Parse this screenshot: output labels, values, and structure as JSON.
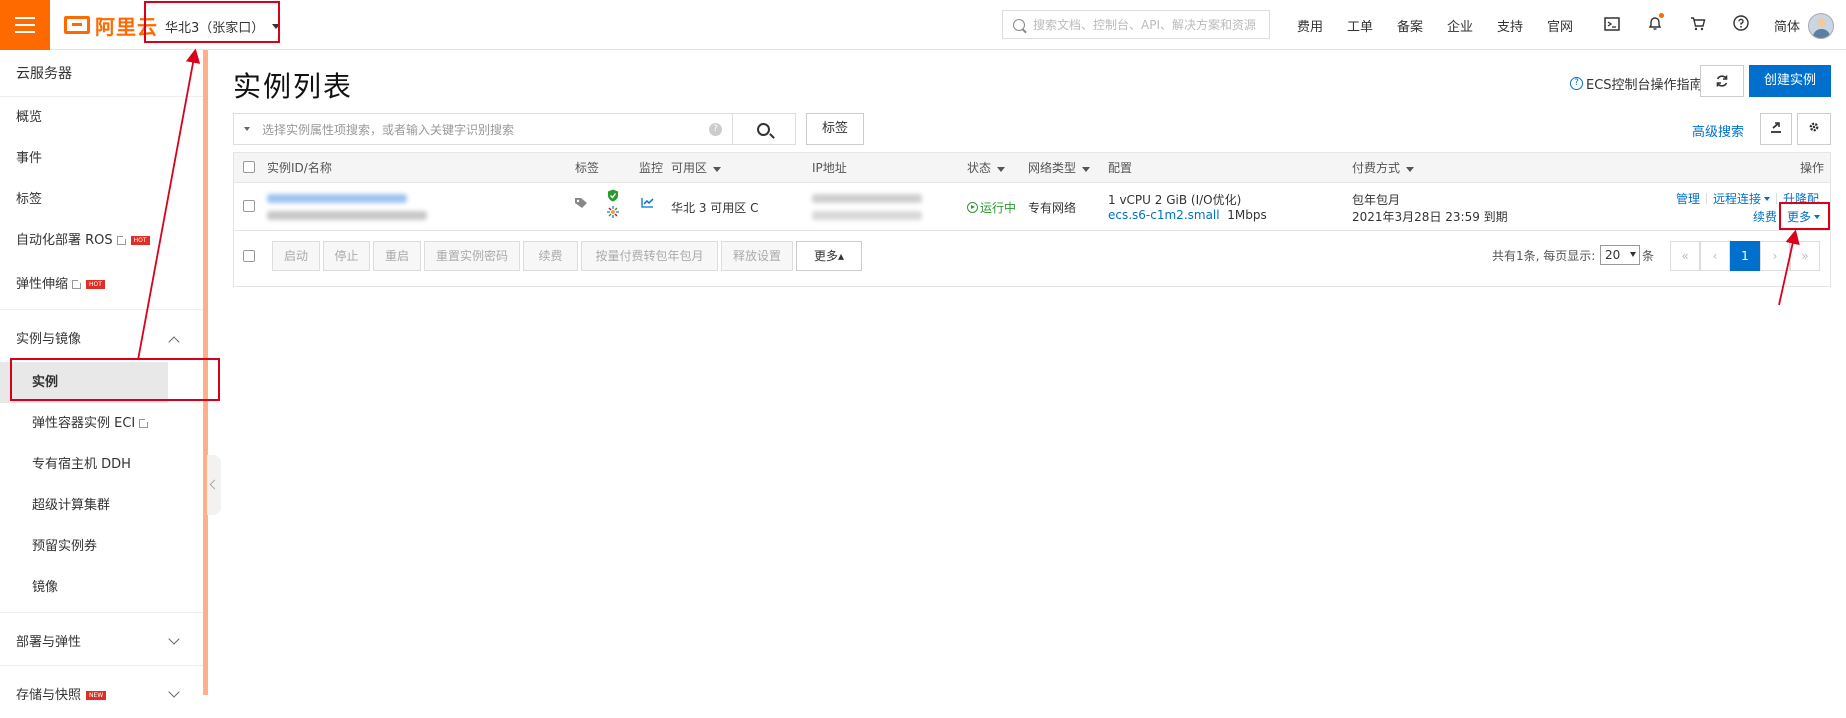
{
  "topbar": {
    "logo_text": "阿里云",
    "region": "华北3（张家口）",
    "search_placeholder": "搜索文档、控制台、API、解决方案和资源",
    "links": [
      "费用",
      "工单",
      "备案",
      "企业",
      "支持",
      "官网"
    ],
    "icons": [
      "terminal-icon",
      "bell-icon",
      "cart-icon",
      "help-icon"
    ],
    "lang": "简体"
  },
  "sidebar": {
    "title": "云服务器",
    "top_items": [
      {
        "label": "概览"
      },
      {
        "label": "事件"
      },
      {
        "label": "标签"
      },
      {
        "label": "自动化部署 ROS",
        "hot": "HOT"
      },
      {
        "label": "弹性伸缩",
        "hot": "HOT"
      }
    ],
    "group1": "实例与镜像",
    "group1_items": [
      {
        "label": "实例"
      },
      {
        "label": "弹性容器实例 ECI"
      },
      {
        "label": "专有宿主机 DDH"
      },
      {
        "label": "超级计算集群"
      },
      {
        "label": "预留实例券"
      },
      {
        "label": "镜像"
      }
    ],
    "group2": "部署与弹性",
    "group3": "存储与快照",
    "group3_badge": "NEW"
  },
  "main": {
    "title": "实例列表",
    "guide": "ECS控制台操作指南",
    "create_button": "创建实例",
    "filter_placeholder": "选择实例属性项搜索，或者输入关键字识别搜索",
    "tag_button": "标签",
    "advanced_search": "高级搜索"
  },
  "table": {
    "headers": {
      "id": "实例ID/名称",
      "tag": "标签",
      "monitor": "监控",
      "zone": "可用区",
      "ip": "IP地址",
      "status": "状态",
      "network": "网络类型",
      "config": "配置",
      "billing": "付费方式",
      "ops": "操作"
    },
    "row": {
      "zone": "华北 3 可用区 C",
      "status": "运行中",
      "network": "专有网络",
      "config_line1": "1 vCPU 2 GiB (I/O优化)",
      "config_spec": "ecs.s6-c1m2.small",
      "config_bw": "1Mbps",
      "billing_line1": "包年包月",
      "billing_line2": "2021年3月28日 23:59 到期",
      "ops": {
        "manage": "管理",
        "remote": "远程连接",
        "upgrade": "升降配",
        "renew": "续费",
        "more": "更多"
      }
    },
    "actions": [
      "启动",
      "停止",
      "重启",
      "重置实例密码",
      "续费",
      "按量付费转包年包月",
      "释放设置"
    ],
    "more_button": "更多▴",
    "pagination": {
      "info": "共有1条, 每页显示:",
      "page_size": "20",
      "unit": "条",
      "current": "1",
      "first": "«",
      "prev": "‹",
      "next": "›",
      "last": "»"
    }
  }
}
